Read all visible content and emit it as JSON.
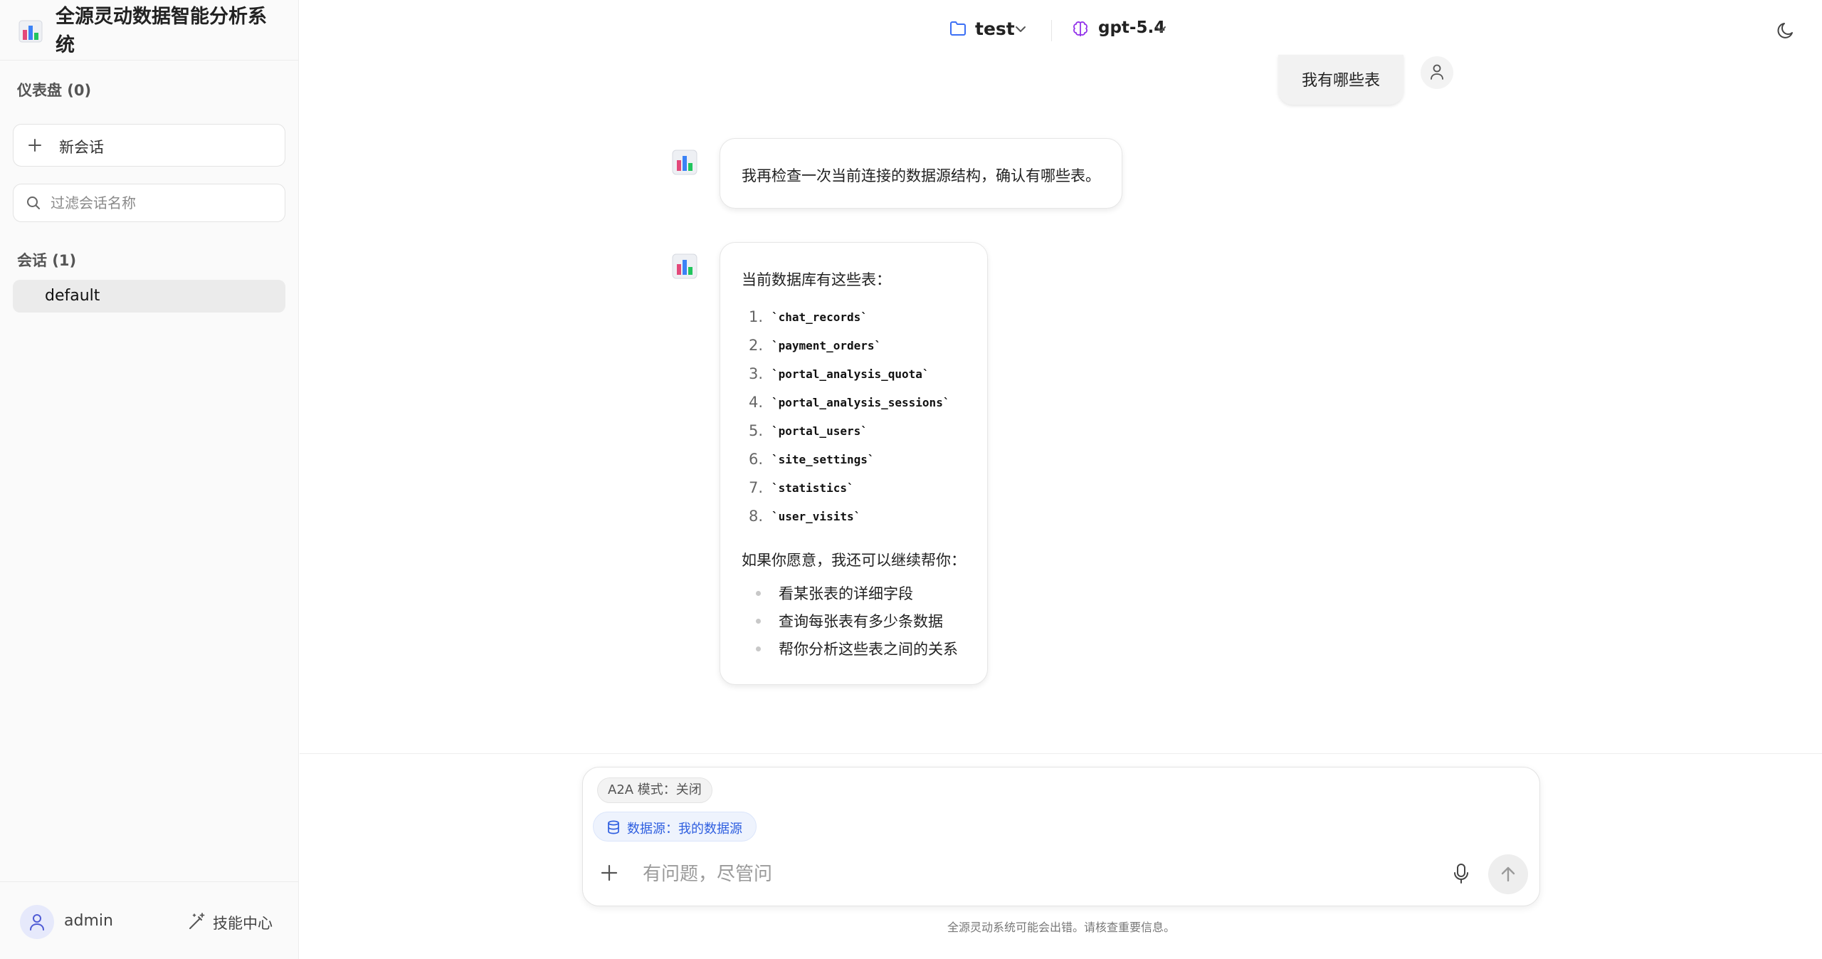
{
  "app": {
    "title": "全源灵动数据智能分析系统"
  },
  "sidebar": {
    "dashboard_label": "仪表盘 (0)",
    "new_chat_label": "新会话",
    "filter_placeholder": "过滤会话名称",
    "conversations_label": "会话 (1)",
    "conversations": [
      {
        "label": "default",
        "selected": true
      }
    ],
    "user": {
      "name": "admin"
    },
    "skills_label": "技能中心"
  },
  "topbar": {
    "project": "test",
    "model": "gpt-5.4"
  },
  "chat": {
    "user_message": "我有哪些表",
    "bot_message_1": "我再检查一次当前连接的数据源结构，确认有哪些表。",
    "bot_message_2": {
      "intro": "当前数据库有这些表：",
      "tables": [
        {
          "num": "1.",
          "name": "`chat_records`"
        },
        {
          "num": "2.",
          "name": "`payment_orders`"
        },
        {
          "num": "3.",
          "name": "`portal_analysis_quota`"
        },
        {
          "num": "4.",
          "name": "`portal_analysis_sessions`"
        },
        {
          "num": "5.",
          "name": "`portal_users`"
        },
        {
          "num": "6.",
          "name": "`site_settings`"
        },
        {
          "num": "7.",
          "name": "`statistics`"
        },
        {
          "num": "8.",
          "name": "`user_visits`"
        }
      ],
      "followup": "如果你愿意，我还可以继续帮你：",
      "suggestions": [
        "看某张表的详细字段",
        "查询每张表有多少条数据",
        "帮你分析这些表之间的关系"
      ]
    }
  },
  "composer": {
    "a2a_chip": "A2A 模式：关闭",
    "datasource_chip": "数据源：我的数据源",
    "placeholder": "有问题，尽管问",
    "disclaimer": "全源灵动系统可能会出错。请核查重要信息。"
  },
  "colors": {
    "accent_blue": "#2f5fe0",
    "model_purple": "#9333ea",
    "folder_blue": "#3b6ff5"
  }
}
